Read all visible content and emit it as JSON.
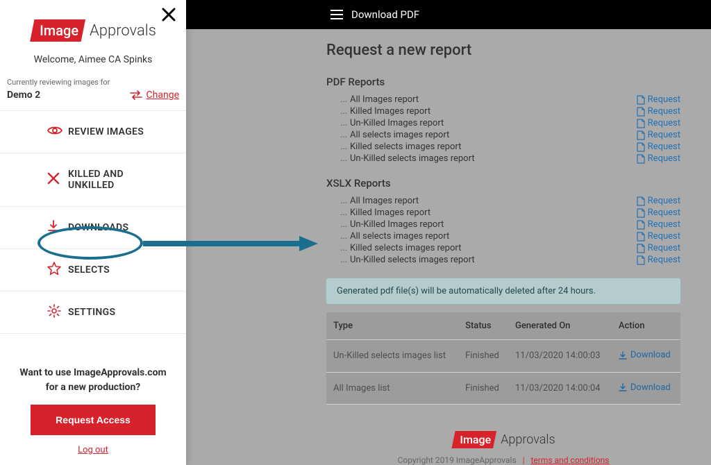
{
  "brand": {
    "mark": "Image",
    "text": "Approvals"
  },
  "sidebar": {
    "welcome": "Welcome, Aimee CA Spinks",
    "reviewing_label": "Currently reviewing images for",
    "project_name": "Demo 2",
    "change_label": "Change",
    "nav": [
      {
        "label": "REVIEW IMAGES"
      },
      {
        "label": "KILLED AND UNKILLED"
      },
      {
        "label": "DOWNLOADS"
      },
      {
        "label": "SELECTS"
      },
      {
        "label": "SETTINGS"
      }
    ],
    "cta_text": "Want to use ImageApprovals.com for a new production?",
    "cta_button": "Request Access",
    "logout": "Log out"
  },
  "topbar": {
    "title": "Download PDF"
  },
  "main": {
    "title": "Request a new report",
    "pdf_section": "PDF Reports",
    "xlsx_section": "XSLX Reports",
    "request_label": "Request",
    "reports": [
      "All Images report",
      "Killed Images report",
      "Un-Killed Images report",
      "All selects images report",
      "Killed selects images report",
      "Un-Killed selects images report"
    ],
    "notice": "Generated pdf file(s) will be automatically deleted after 24 hours.",
    "table": {
      "headers": {
        "type": "Type",
        "status": "Status",
        "generated": "Generated On",
        "action": "Action"
      },
      "download_label": "Download",
      "rows": [
        {
          "type": "Un-Killed selects images list",
          "status": "Finished",
          "generated": "11/03/2020 14:00:03"
        },
        {
          "type": "All Images list",
          "status": "Finished",
          "generated": "11/03/2020 14:00:04"
        }
      ]
    }
  },
  "footer": {
    "copyright": "Copyright 2019 ImageApprovals",
    "terms": "terms and conditions"
  }
}
